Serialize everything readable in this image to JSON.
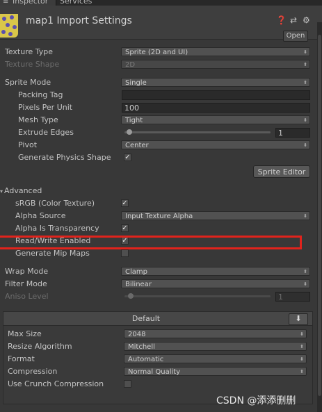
{
  "tabs": {
    "inspector": "Inspector",
    "services": "Services"
  },
  "header": {
    "title": "map1 Import Settings",
    "open_button": "Open",
    "icons": [
      "help-icon",
      "settings-sliders-icon",
      "gear-icon"
    ]
  },
  "texture_type": {
    "label": "Texture Type",
    "value": "Sprite (2D and UI)"
  },
  "texture_shape": {
    "label": "Texture Shape",
    "value": "2D"
  },
  "sprite_mode": {
    "label": "Sprite Mode",
    "value": "Single"
  },
  "packing_tag": {
    "label": "Packing Tag",
    "value": ""
  },
  "pixels_per_unit": {
    "label": "Pixels Per Unit",
    "value": "100"
  },
  "mesh_type": {
    "label": "Mesh Type",
    "value": "Tight"
  },
  "extrude_edges": {
    "label": "Extrude Edges",
    "value": "1"
  },
  "pivot": {
    "label": "Pivot",
    "value": "Center"
  },
  "physics_shape": {
    "label": "Generate Physics Shape",
    "checked": true
  },
  "sprite_editor": {
    "label": "Sprite Editor"
  },
  "advanced": {
    "label": "Advanced",
    "srgb": {
      "label": "sRGB (Color Texture)",
      "checked": true
    },
    "alpha_source": {
      "label": "Alpha Source",
      "value": "Input Texture Alpha"
    },
    "alpha_transparency": {
      "label": "Alpha Is Transparency",
      "checked": true
    },
    "read_write": {
      "label": "Read/Write Enabled",
      "checked": true
    },
    "mip_maps": {
      "label": "Generate Mip Maps",
      "checked": false
    }
  },
  "wrap_mode": {
    "label": "Wrap Mode",
    "value": "Clamp"
  },
  "filter_mode": {
    "label": "Filter Mode",
    "value": "Bilinear"
  },
  "aniso_level": {
    "label": "Aniso Level",
    "value": "1"
  },
  "platform": {
    "tab_label": "Default",
    "download_icon": "download-icon",
    "max_size": {
      "label": "Max Size",
      "value": "2048"
    },
    "resize": {
      "label": "Resize Algorithm",
      "value": "Mitchell"
    },
    "format": {
      "label": "Format",
      "value": "Automatic"
    },
    "compression": {
      "label": "Compression",
      "value": "Normal Quality"
    },
    "crunch": {
      "label": "Use Crunch Compression",
      "checked": false
    }
  },
  "watermark": "CSDN @添添删删",
  "colors": {
    "background": "#383838",
    "highlight": "#e1231c"
  }
}
